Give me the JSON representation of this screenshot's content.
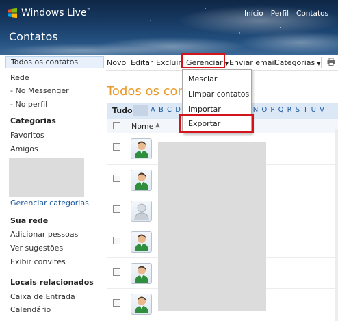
{
  "header": {
    "brand": "Windows Live",
    "brand_tm": "™",
    "nav": [
      "Início",
      "Perfil",
      "Contatos"
    ],
    "page_title": "Contatos"
  },
  "sidebar": {
    "items": [
      "Todos os contatos",
      "Rede",
      "- No Messenger",
      "- No perfil"
    ],
    "categories_heading": "Categorias",
    "categories": [
      "Favoritos",
      "Amigos"
    ],
    "manage_categories": "Gerenciar categorias",
    "network_heading": "Sua rede",
    "network_items": [
      "Adicionar pessoas",
      "Ver sugestões",
      "Exibir convites"
    ],
    "related_heading": "Locais relacionados",
    "related_items": [
      "Caixa de Entrada",
      "Calendário"
    ]
  },
  "toolbar": {
    "new": "Novo",
    "edit": "Editar",
    "delete": "Excluir",
    "manage": "Gerenciar",
    "send_email": "Enviar email",
    "categories": "Categorias"
  },
  "main": {
    "title": "Todos os conta",
    "filter_all": "Tudo",
    "letters": "A B C D E F G H I J K L M N O P Q R S T U V",
    "column_name": "Nome",
    "sort_icon": "sort-up-icon"
  },
  "manage_menu": {
    "items": [
      "Mesclar",
      "Limpar contatos",
      "Importar",
      "Exportar"
    ]
  },
  "contacts": {
    "avatars": [
      "person-green-icon",
      "person-green-icon",
      "person-gray-icon",
      "person-green-icon",
      "person-green-icon",
      "person-green-icon"
    ]
  },
  "colors": {
    "highlight": "#d4141c",
    "title_orange": "#e79a2b",
    "link_blue": "#1e5aa0"
  }
}
